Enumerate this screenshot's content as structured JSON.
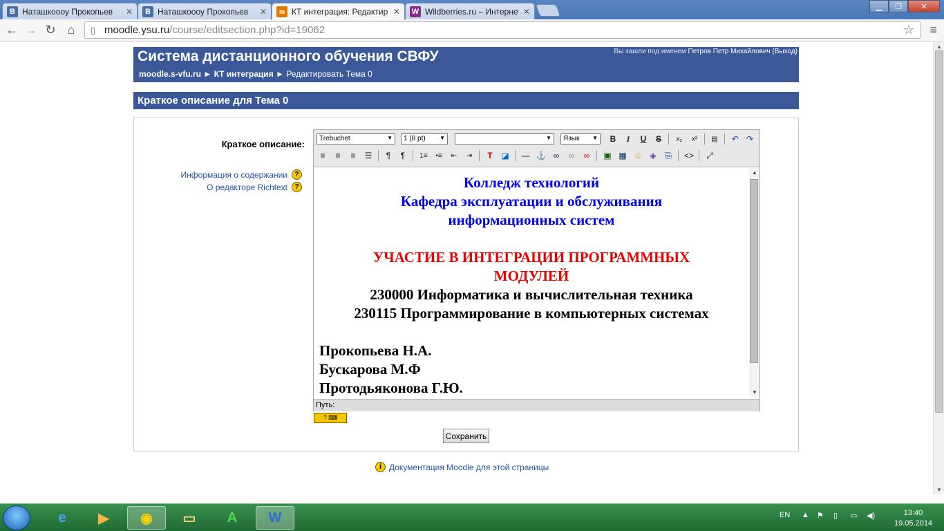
{
  "browser": {
    "tabs": [
      {
        "label": "Наташкоооу Прокопьев",
        "favicon": "В",
        "color": "#4a6fa5",
        "active": false
      },
      {
        "label": "Наташкоооу Прокопьев",
        "favicon": "В",
        "color": "#4a6fa5",
        "active": false
      },
      {
        "label": "КТ интеграция: Редактир",
        "favicon": "moodle",
        "color": "#e07b00",
        "active": true
      },
      {
        "label": "Wildberries.ru – Интернет",
        "favicon": "W",
        "color": "#8b2c8b",
        "active": false
      }
    ],
    "url_host": "moodle.ysu.ru",
    "url_path": "/course/editsection.php?id=19062"
  },
  "header": {
    "site_name": "Система дистанционного обучения СВФУ",
    "login_prefix": "Вы зашли под именем ",
    "login_user": "Петров Петр Михайлович (Выход)",
    "breadcrumb": {
      "home": "moodle.s-vfu.ru",
      "sep": " ► ",
      "course": "КТ интеграция",
      "current": "Редактировать Тема 0"
    }
  },
  "section_heading": "Краткое описание для Тема 0",
  "form": {
    "field_label": "Краткое описание:",
    "help_links": [
      "Информация о содержании",
      "О редакторе Richtext"
    ]
  },
  "editor": {
    "font_select": "Trebuchet",
    "size_select": "1 (8 pt)",
    "format_select": "",
    "lang_select": "Язык",
    "content_centered": [
      {
        "text": "Колледж технологий",
        "color": "blue"
      },
      {
        "text": "Кафедра эксплуатации и обслуживания",
        "color": "blue"
      },
      {
        "text": "информационных систем",
        "color": "blue"
      },
      {
        "text": "",
        "color": "black"
      },
      {
        "text": "УЧАСТИЕ В ИНТЕГРАЦИИ ПРОГРАММНЫХ",
        "color": "red"
      },
      {
        "text": "МОДУЛЕЙ",
        "color": "red"
      },
      {
        "text": "230000 Информатика и вычислительная техника",
        "color": "black"
      },
      {
        "text": "230115 Программирование в компьютерных системах",
        "color": "black"
      },
      {
        "text": "",
        "color": "black"
      }
    ],
    "content_left": [
      "Прокопьева Н.А.",
      "Бускарова М.Ф",
      "Протодьяконова Г.Ю."
    ],
    "path_label": "Путь:"
  },
  "save_button": "Сохранить",
  "doc_link": "Документация Moodle для этой страницы",
  "taskbar": {
    "lang": "EN",
    "time": "13:40",
    "date": "19.05.2014"
  }
}
